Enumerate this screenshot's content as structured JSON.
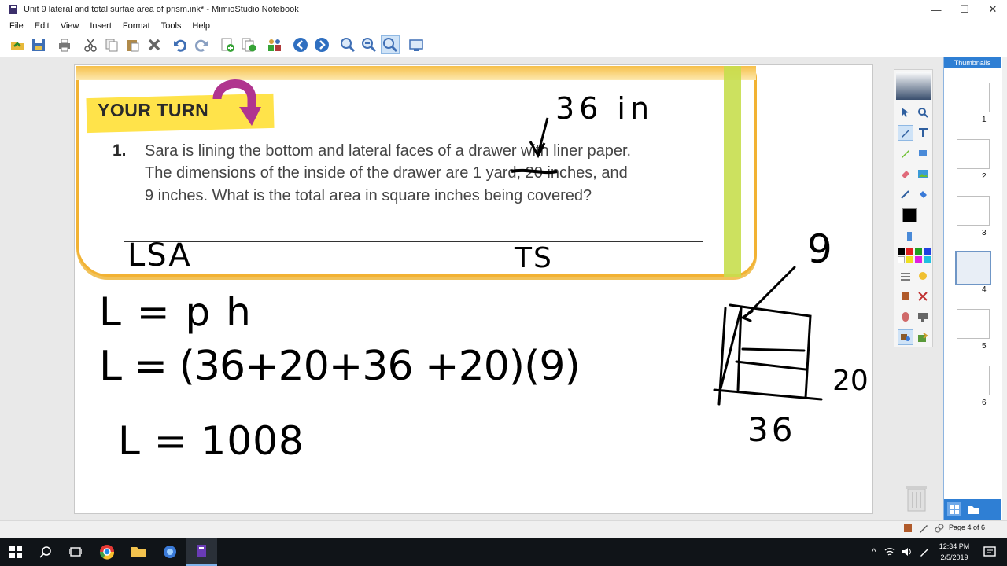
{
  "window": {
    "title": "Unit 9 lateral and total surfae area of prism.ink* - MimioStudio Notebook",
    "min_glyph": "—",
    "max_glyph": "☐",
    "close_glyph": "✕"
  },
  "menu": [
    "File",
    "Edit",
    "View",
    "Insert",
    "Format",
    "Tools",
    "Help"
  ],
  "toolbar_icons": [
    "open-icon",
    "save-icon",
    "print-icon",
    "cut-icon",
    "copy-icon",
    "paste-icon",
    "delete-icon",
    "undo-icon",
    "redo-icon",
    "new-page-icon",
    "duplicate-page-icon",
    "users-icon",
    "back-icon",
    "forward-icon",
    "zoom-in-icon",
    "zoom-out-icon",
    "zoom-fit-icon",
    "screen-icon"
  ],
  "textbook": {
    "banner": "YOUR TURN",
    "question_number": "1.",
    "lines": [
      "Sara is lining the bottom and lateral faces of a drawer with liner paper.",
      "The dimensions of the inside of the drawer are 1 yard, 20 inches, and",
      "9 inches. What is the total area in square inches being covered?"
    ]
  },
  "handwriting": {
    "annotation_top": "36 in",
    "lsa": "LSA",
    "ts": "TS",
    "line1": "L = p h",
    "line2": "L = (36+20+36 +20)(9)",
    "line3": "L = 1008",
    "dim_height": "9",
    "dim_width": "20",
    "dim_length": "36"
  },
  "thumbnails": {
    "header": "Thumbnails",
    "pages": [
      "1",
      "2",
      "3",
      "4",
      "5",
      "6"
    ],
    "current": 4
  },
  "status": {
    "page_indicator": "Page 4 of 6"
  },
  "taskbar": {
    "time": "12:34 PM",
    "date": "2/5/2019"
  },
  "colors": {
    "accent": "#2f7fd4",
    "card_border": "#f2b233",
    "banner": "#ffe34a",
    "arrow": "#b0348f"
  }
}
